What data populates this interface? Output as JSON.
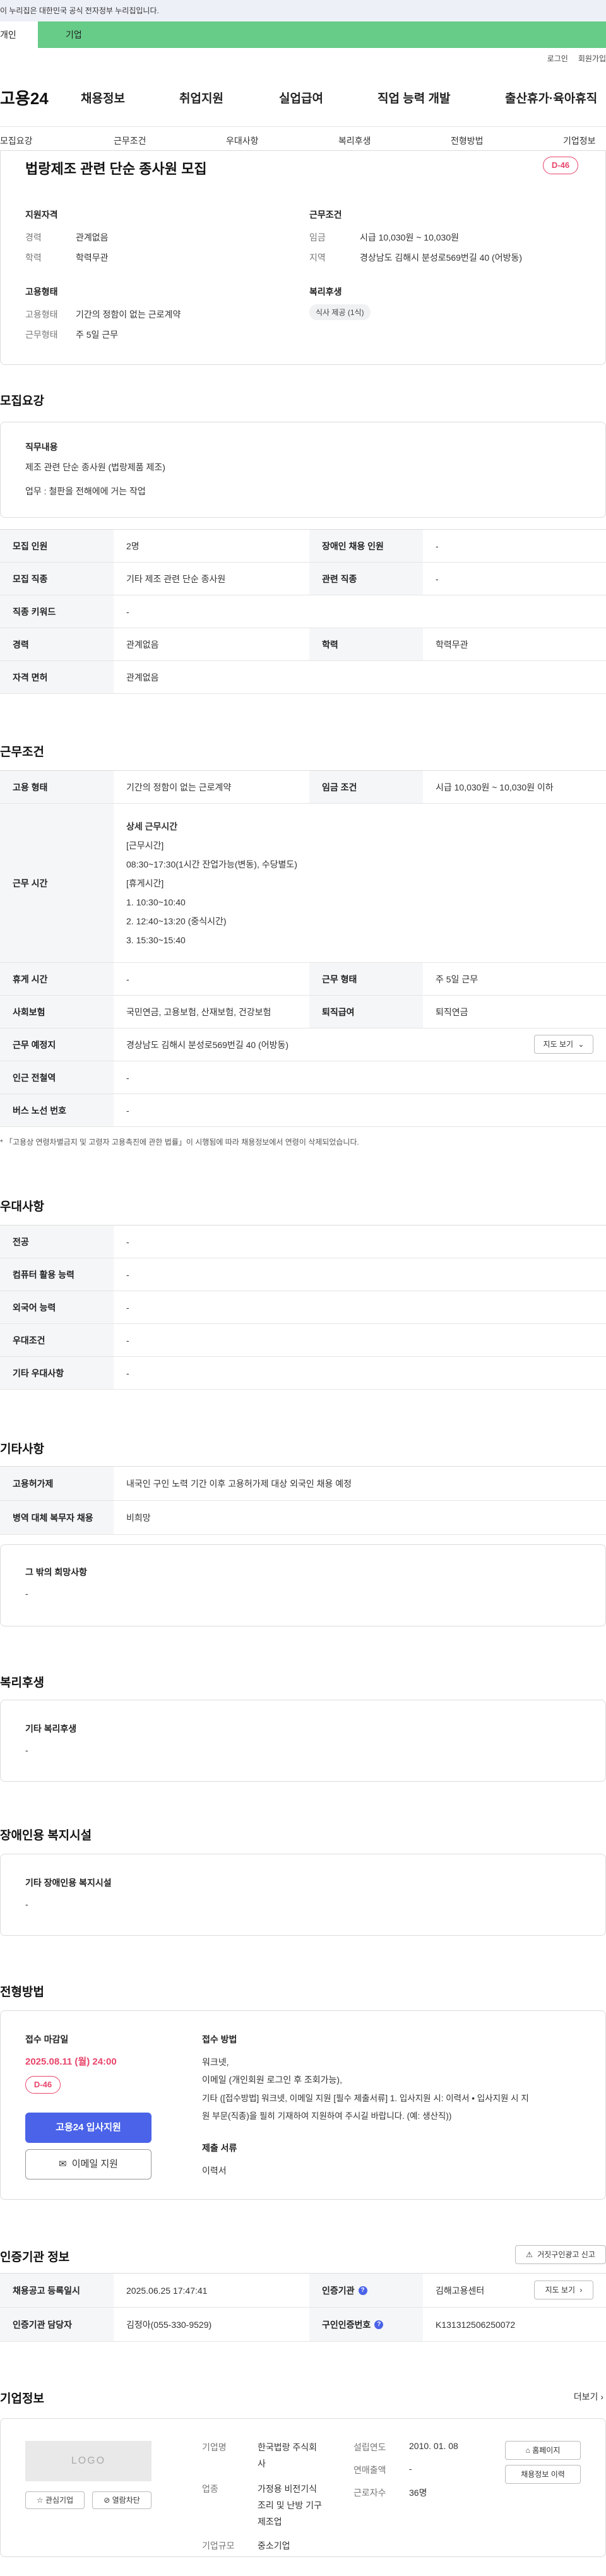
{
  "gov_banner": "이 누리집은 대한민국 공식 전자정부 누리집입니다.",
  "tabs": {
    "personal": "개인",
    "corporate": "기업"
  },
  "util": {
    "login": "로그인",
    "join": "회원가입"
  },
  "brand": "고용24",
  "gnb": [
    "채용정보",
    "취업지원",
    "실업급여",
    "직업 능력 개발",
    "출산휴가·육아휴직"
  ],
  "lnb": [
    "모집요강",
    "근무조건",
    "우대사항",
    "복리후생",
    "전형방법",
    "기업정보"
  ],
  "job": {
    "title": "법랑제조 관련 단순 종사원 모집",
    "dday": "D-46"
  },
  "summary": {
    "qual_title": "지원자격",
    "career_k": "경력",
    "career_v": "관계없음",
    "edu_k": "학력",
    "edu_v": "학력무관",
    "cond_title": "근무조건",
    "wage_k": "임금",
    "wage_v": "시급 10,030원 ~ 10,030원",
    "area_k": "지역",
    "area_v": "경상남도 김해시 분성로569번길 40 (어방동)",
    "emp_title": "고용형태",
    "emptype_k": "고용형태",
    "emptype_v": "기간의 정함이 없는 근로계약",
    "worktype_k": "근무형태",
    "worktype_v": "주 5일 근무",
    "welfare_title": "복리후생",
    "welfare_chip": "식사 제공 (1식)"
  },
  "recruit": {
    "title": "모집요강",
    "duty_title": "직무내용",
    "duty_line1": "제조 관련 단순 종사원 (법랑제품 제조)",
    "duty_line2": "업무 : 철판을 전해에에 거는 작업",
    "rows": [
      [
        "모집 인원",
        "2명",
        "장애인 채용 인원",
        "-"
      ],
      [
        "모집 직종",
        "기타 제조 관련 단순 종사원",
        "관련 직종",
        "-"
      ],
      [
        "직종 키워드",
        "-"
      ],
      [
        "경력",
        "관계없음",
        "학력",
        "학력무관"
      ],
      [
        "자격 면허",
        "관계없음"
      ]
    ]
  },
  "work": {
    "title": "근무조건",
    "emp_k": "고용 형태",
    "emp_v": "기간의 정함이 없는 근로계약",
    "wage_k": "임금 조건",
    "wage_v": "시급 10,030원 ~ 10,030원 이하",
    "time_k": "근무 시간",
    "time_lines": [
      "상세 근무시간",
      "[근무시간]",
      "08:30~17:30(1시간 잔업가능(변동), 수당별도)",
      "[휴게시간]",
      "1. 10:30~10:40",
      "2. 12:40~13:20 (중식시간)",
      "3. 15:30~15:40"
    ],
    "rest_k": "휴게 시간",
    "rest_v": "-",
    "form_k": "근무 형태",
    "form_v": "주 5일 근무",
    "ins_k": "사회보험",
    "ins_v": "국민연금, 고용보험, 산재보험, 건강보험",
    "ret_k": "퇴직급여",
    "ret_v": "퇴직연금",
    "place_k": "근무 예정지",
    "place_v": "경상남도 김해시 분성로569번길 40 (어방동)",
    "map_btn": "지도 보기",
    "sub_k": "인근 전철역",
    "sub_v": "-",
    "bus_k": "버스 노선 번호",
    "bus_v": "-",
    "note": "* 「고용상 연령차별금지 및 고령자 고용촉진에 관한 법률」이 시행됨에 따라 채용정보에서 연령이 삭제되었습니다."
  },
  "pref": {
    "title": "우대사항",
    "rows": [
      [
        "전공",
        "-"
      ],
      [
        "컴퓨터 활용 능력",
        "-"
      ],
      [
        "외국어 능력",
        "-"
      ],
      [
        "우대조건",
        "-"
      ],
      [
        "기타 우대사항",
        "-"
      ]
    ]
  },
  "etc": {
    "title": "기타사항",
    "rows": [
      [
        "고용허가제",
        "내국인 구인 노력 기간 이후 고용허가제 대상 외국인 채용 예정"
      ],
      [
        "병역 대체 복무자 채용",
        "비희망"
      ]
    ],
    "box_title": "그 밖의 희망사항",
    "box_text": "-"
  },
  "welfare": {
    "title": "복리후생",
    "box_title": "기타 복리후생",
    "box_text": "-"
  },
  "disabled": {
    "title": "장애인용 복지시설",
    "box_title": "기타 장애인용 복지시설",
    "box_text": "-"
  },
  "process": {
    "title": "전형방법",
    "deadline_title": "접수 마감일",
    "deadline_value": "2025.08.11 (월) 24:00",
    "dday": "D-46",
    "apply_btn": "고용24 입사지원",
    "email_btn": "이메일 지원",
    "method_title": "접수 방법",
    "method_lines": [
      "워크넷,",
      "이메일 (개인회원 로그인 후 조회가능),",
      "기타 ([접수방법] 워크넷, 이메일 지원 [필수 제출서류] 1. 입사지원 시: 이력서 • 입사지원 시 지",
      "원 부문(직종)을 필히 기재하여 지원하여 주시길 바랍니다. (예: 생산직))"
    ],
    "docs_title": "제출 서류",
    "docs_value": "이력서"
  },
  "auth": {
    "title": "인증기관 정보",
    "report_btn": "거짓구인광고 신고",
    "reg_k": "채용공고 등록일시",
    "reg_v": "2025.06.25 17:47:41",
    "org_k": "인증기관",
    "org_v": "김해고용센터",
    "map_btn": "지도 보기",
    "mgr_k": "인증기관 담당자",
    "mgr_v": "김정아(055-330-9529)",
    "num_k": "구인인증번호",
    "num_v": "K131312506250072"
  },
  "company": {
    "title": "기업정보",
    "more": "더보기",
    "logo": "LOGO",
    "fav_btn": "관심기업",
    "block_btn": "열람차단",
    "name_k": "기업명",
    "name_v1": "한국법랑 주식회",
    "name_v2": "사",
    "biz_k": "업종",
    "biz_v1": "가정용 비전기식",
    "biz_v2": "조리 및 난방 기구",
    "biz_v3": "제조업",
    "size_k": "기업규모",
    "size_v": "중소기업",
    "est_k": "설립연도",
    "est_v": "2010. 01. 08",
    "sales_k": "연매출액",
    "sales_v": "-",
    "emp_k": "근로자수",
    "emp_v": "36명",
    "home_btn": "홈페이지",
    "jobs_btn": "채용정보 이력"
  }
}
